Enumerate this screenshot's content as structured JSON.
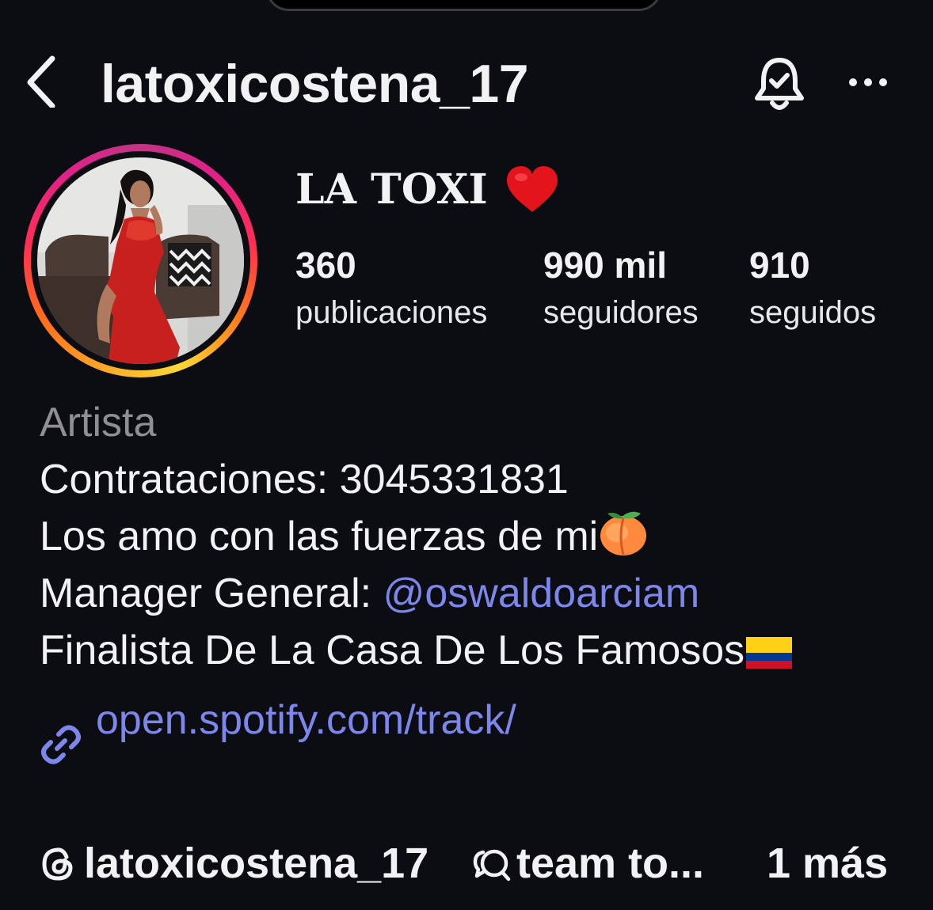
{
  "header": {
    "username": "latoxicostena_17",
    "back_icon": "chevron-left-icon",
    "bell_icon": "bell-check-icon",
    "more_icon": "more-horizontal-icon"
  },
  "profile": {
    "display_name": "LA TOXI",
    "display_name_emoji": "red-heart-icon",
    "story_ring_colors": [
      "#f9a825",
      "#ff2d55",
      "#c13584"
    ],
    "stats": [
      {
        "value": "360",
        "label": "publicaciones"
      },
      {
        "value": "990 mil",
        "label": "seguidores"
      },
      {
        "value": "910",
        "label": "seguidos"
      }
    ]
  },
  "bio": {
    "category": "Artista",
    "line1": "Contrataciones: 3045331831",
    "line2": "Los amo con las fuerzas de mi",
    "line2_emoji": "peach-icon",
    "line3_prefix": "Manager General: ",
    "line3_mention": "@oswaldoarciam",
    "line4": "Finalista De La Casa De Los Famosos",
    "line4_emoji": "colombia-flag-icon",
    "link_color": "#7d86ea"
  },
  "link": {
    "text": "open.spotify.com/track/",
    "icon": "link-icon"
  },
  "footer": {
    "threads_handle": "latoxicostena_17",
    "chat_label": "team to...",
    "more_label": "1 más"
  }
}
